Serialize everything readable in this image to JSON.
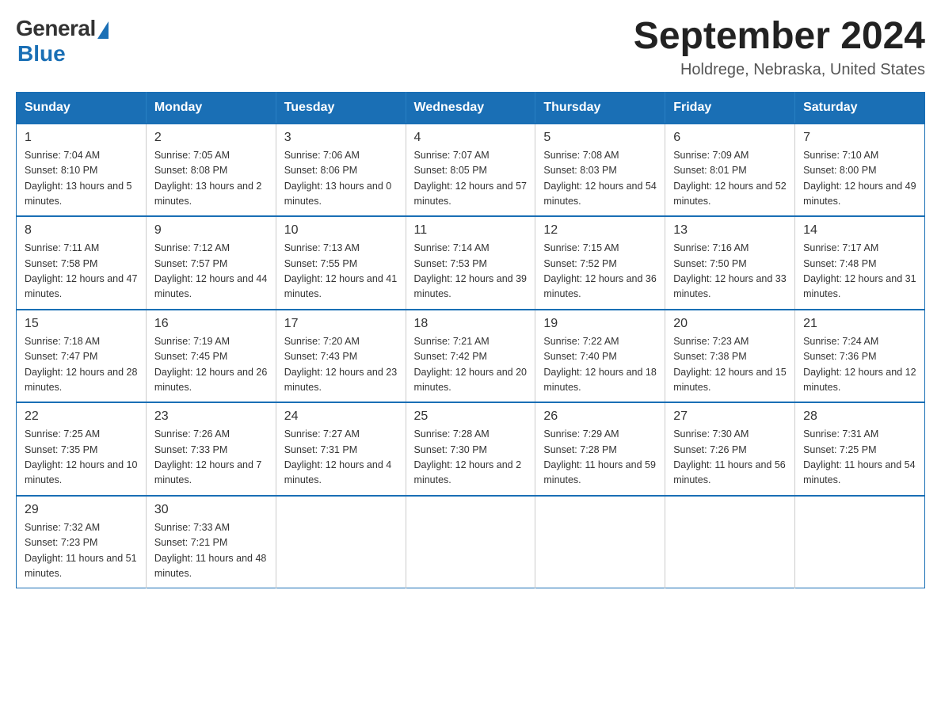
{
  "header": {
    "logo": {
      "general": "General",
      "blue": "Blue"
    },
    "title": "September 2024",
    "location": "Holdrege, Nebraska, United States"
  },
  "calendar": {
    "days_of_week": [
      "Sunday",
      "Monday",
      "Tuesday",
      "Wednesday",
      "Thursday",
      "Friday",
      "Saturday"
    ],
    "weeks": [
      [
        {
          "day": "1",
          "sunrise": "7:04 AM",
          "sunset": "8:10 PM",
          "daylight": "13 hours and 5 minutes."
        },
        {
          "day": "2",
          "sunrise": "7:05 AM",
          "sunset": "8:08 PM",
          "daylight": "13 hours and 2 minutes."
        },
        {
          "day": "3",
          "sunrise": "7:06 AM",
          "sunset": "8:06 PM",
          "daylight": "13 hours and 0 minutes."
        },
        {
          "day": "4",
          "sunrise": "7:07 AM",
          "sunset": "8:05 PM",
          "daylight": "12 hours and 57 minutes."
        },
        {
          "day": "5",
          "sunrise": "7:08 AM",
          "sunset": "8:03 PM",
          "daylight": "12 hours and 54 minutes."
        },
        {
          "day": "6",
          "sunrise": "7:09 AM",
          "sunset": "8:01 PM",
          "daylight": "12 hours and 52 minutes."
        },
        {
          "day": "7",
          "sunrise": "7:10 AM",
          "sunset": "8:00 PM",
          "daylight": "12 hours and 49 minutes."
        }
      ],
      [
        {
          "day": "8",
          "sunrise": "7:11 AM",
          "sunset": "7:58 PM",
          "daylight": "12 hours and 47 minutes."
        },
        {
          "day": "9",
          "sunrise": "7:12 AM",
          "sunset": "7:57 PM",
          "daylight": "12 hours and 44 minutes."
        },
        {
          "day": "10",
          "sunrise": "7:13 AM",
          "sunset": "7:55 PM",
          "daylight": "12 hours and 41 minutes."
        },
        {
          "day": "11",
          "sunrise": "7:14 AM",
          "sunset": "7:53 PM",
          "daylight": "12 hours and 39 minutes."
        },
        {
          "day": "12",
          "sunrise": "7:15 AM",
          "sunset": "7:52 PM",
          "daylight": "12 hours and 36 minutes."
        },
        {
          "day": "13",
          "sunrise": "7:16 AM",
          "sunset": "7:50 PM",
          "daylight": "12 hours and 33 minutes."
        },
        {
          "day": "14",
          "sunrise": "7:17 AM",
          "sunset": "7:48 PM",
          "daylight": "12 hours and 31 minutes."
        }
      ],
      [
        {
          "day": "15",
          "sunrise": "7:18 AM",
          "sunset": "7:47 PM",
          "daylight": "12 hours and 28 minutes."
        },
        {
          "day": "16",
          "sunrise": "7:19 AM",
          "sunset": "7:45 PM",
          "daylight": "12 hours and 26 minutes."
        },
        {
          "day": "17",
          "sunrise": "7:20 AM",
          "sunset": "7:43 PM",
          "daylight": "12 hours and 23 minutes."
        },
        {
          "day": "18",
          "sunrise": "7:21 AM",
          "sunset": "7:42 PM",
          "daylight": "12 hours and 20 minutes."
        },
        {
          "day": "19",
          "sunrise": "7:22 AM",
          "sunset": "7:40 PM",
          "daylight": "12 hours and 18 minutes."
        },
        {
          "day": "20",
          "sunrise": "7:23 AM",
          "sunset": "7:38 PM",
          "daylight": "12 hours and 15 minutes."
        },
        {
          "day": "21",
          "sunrise": "7:24 AM",
          "sunset": "7:36 PM",
          "daylight": "12 hours and 12 minutes."
        }
      ],
      [
        {
          "day": "22",
          "sunrise": "7:25 AM",
          "sunset": "7:35 PM",
          "daylight": "12 hours and 10 minutes."
        },
        {
          "day": "23",
          "sunrise": "7:26 AM",
          "sunset": "7:33 PM",
          "daylight": "12 hours and 7 minutes."
        },
        {
          "day": "24",
          "sunrise": "7:27 AM",
          "sunset": "7:31 PM",
          "daylight": "12 hours and 4 minutes."
        },
        {
          "day": "25",
          "sunrise": "7:28 AM",
          "sunset": "7:30 PM",
          "daylight": "12 hours and 2 minutes."
        },
        {
          "day": "26",
          "sunrise": "7:29 AM",
          "sunset": "7:28 PM",
          "daylight": "11 hours and 59 minutes."
        },
        {
          "day": "27",
          "sunrise": "7:30 AM",
          "sunset": "7:26 PM",
          "daylight": "11 hours and 56 minutes."
        },
        {
          "day": "28",
          "sunrise": "7:31 AM",
          "sunset": "7:25 PM",
          "daylight": "11 hours and 54 minutes."
        }
      ],
      [
        {
          "day": "29",
          "sunrise": "7:32 AM",
          "sunset": "7:23 PM",
          "daylight": "11 hours and 51 minutes."
        },
        {
          "day": "30",
          "sunrise": "7:33 AM",
          "sunset": "7:21 PM",
          "daylight": "11 hours and 48 minutes."
        },
        null,
        null,
        null,
        null,
        null
      ]
    ],
    "labels": {
      "sunrise": "Sunrise:",
      "sunset": "Sunset:",
      "daylight": "Daylight:"
    }
  }
}
